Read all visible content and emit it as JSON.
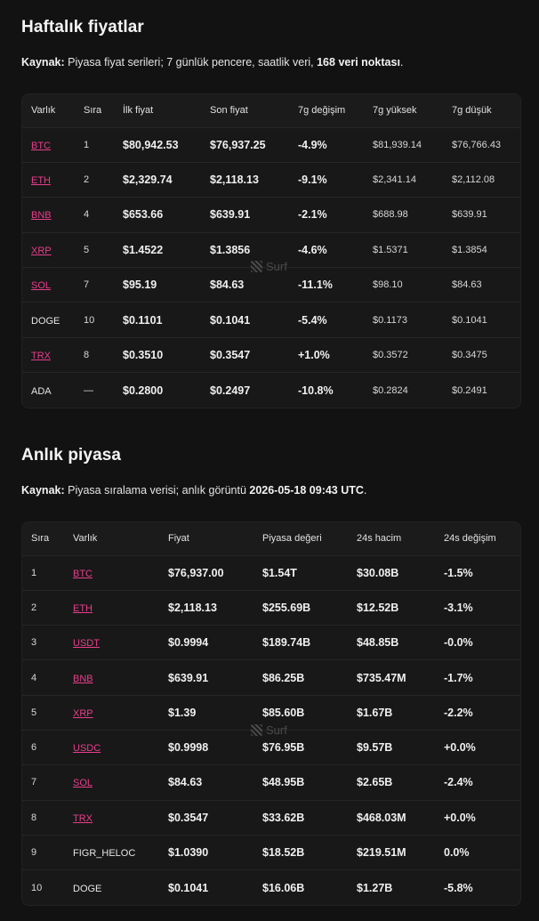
{
  "weekly": {
    "title": "Haftalık fiyatlar",
    "source_label": "Kaynak:",
    "source_text": " Piyasa fiyat serileri; 7 günlük pencere, saatlik veri, ",
    "source_bold": "168 veri noktası",
    "source_end": ".",
    "headers": [
      "Varlık",
      "Sıra",
      "İlk fiyat",
      "Son fiyat",
      "7g değişim",
      "7g yüksek",
      "7g düşük"
    ],
    "rows": [
      {
        "asset": "BTC",
        "link": true,
        "rank": "1",
        "first": "$80,942.53",
        "last": "$76,937.25",
        "change": "-4.9%",
        "high": "$81,939.14",
        "low": "$76,766.43"
      },
      {
        "asset": "ETH",
        "link": true,
        "rank": "2",
        "first": "$2,329.74",
        "last": "$2,118.13",
        "change": "-9.1%",
        "high": "$2,341.14",
        "low": "$2,112.08"
      },
      {
        "asset": "BNB",
        "link": true,
        "rank": "4",
        "first": "$653.66",
        "last": "$639.91",
        "change": "-2.1%",
        "high": "$688.98",
        "low": "$639.91"
      },
      {
        "asset": "XRP",
        "link": true,
        "rank": "5",
        "first": "$1.4522",
        "last": "$1.3856",
        "change": "-4.6%",
        "high": "$1.5371",
        "low": "$1.3854"
      },
      {
        "asset": "SOL",
        "link": true,
        "rank": "7",
        "first": "$95.19",
        "last": "$84.63",
        "change": "-11.1%",
        "high": "$98.10",
        "low": "$84.63"
      },
      {
        "asset": "DOGE",
        "link": false,
        "rank": "10",
        "first": "$0.1101",
        "last": "$0.1041",
        "change": "-5.4%",
        "high": "$0.1173",
        "low": "$0.1041"
      },
      {
        "asset": "TRX",
        "link": true,
        "rank": "8",
        "first": "$0.3510",
        "last": "$0.3547",
        "change": "+1.0%",
        "high": "$0.3572",
        "low": "$0.3475"
      },
      {
        "asset": "ADA",
        "link": false,
        "rank": "—",
        "first": "$0.2800",
        "last": "$0.2497",
        "change": "-10.8%",
        "high": "$0.2824",
        "low": "$0.2491"
      }
    ]
  },
  "market": {
    "title": "Anlık piyasa",
    "source_label": "Kaynak:",
    "source_text": " Piyasa sıralama verisi; anlık görüntü ",
    "source_bold": "2026-05-18 09:43 UTC",
    "source_end": ".",
    "headers": [
      "Sıra",
      "Varlık",
      "Fiyat",
      "Piyasa değeri",
      "24s hacim",
      "24s değişim"
    ],
    "rows": [
      {
        "rank": "1",
        "asset": "BTC",
        "link": true,
        "price": "$76,937.00",
        "cap": "$1.54T",
        "volume": "$30.08B",
        "change": "-1.5%"
      },
      {
        "rank": "2",
        "asset": "ETH",
        "link": true,
        "price": "$2,118.13",
        "cap": "$255.69B",
        "volume": "$12.52B",
        "change": "-3.1%"
      },
      {
        "rank": "3",
        "asset": "USDT",
        "link": true,
        "price": "$0.9994",
        "cap": "$189.74B",
        "volume": "$48.85B",
        "change": "-0.0%"
      },
      {
        "rank": "4",
        "asset": "BNB",
        "link": true,
        "price": "$639.91",
        "cap": "$86.25B",
        "volume": "$735.47M",
        "change": "-1.7%"
      },
      {
        "rank": "5",
        "asset": "XRP",
        "link": true,
        "price": "$1.39",
        "cap": "$85.60B",
        "volume": "$1.67B",
        "change": "-2.2%"
      },
      {
        "rank": "6",
        "asset": "USDC",
        "link": true,
        "price": "$0.9998",
        "cap": "$76.95B",
        "volume": "$9.57B",
        "change": "+0.0%"
      },
      {
        "rank": "7",
        "asset": "SOL",
        "link": true,
        "price": "$84.63",
        "cap": "$48.95B",
        "volume": "$2.65B",
        "change": "-2.4%"
      },
      {
        "rank": "8",
        "asset": "TRX",
        "link": true,
        "price": "$0.3547",
        "cap": "$33.62B",
        "volume": "$468.03M",
        "change": "+0.0%"
      },
      {
        "rank": "9",
        "asset": "FIGR_HELOC",
        "link": false,
        "price": "$1.0390",
        "cap": "$18.52B",
        "volume": "$219.51M",
        "change": "0.0%"
      },
      {
        "rank": "10",
        "asset": "DOGE",
        "link": false,
        "price": "$0.1041",
        "cap": "$16.06B",
        "volume": "$1.27B",
        "change": "-5.8%"
      }
    ]
  },
  "watermark": {
    "text": "Surf"
  }
}
